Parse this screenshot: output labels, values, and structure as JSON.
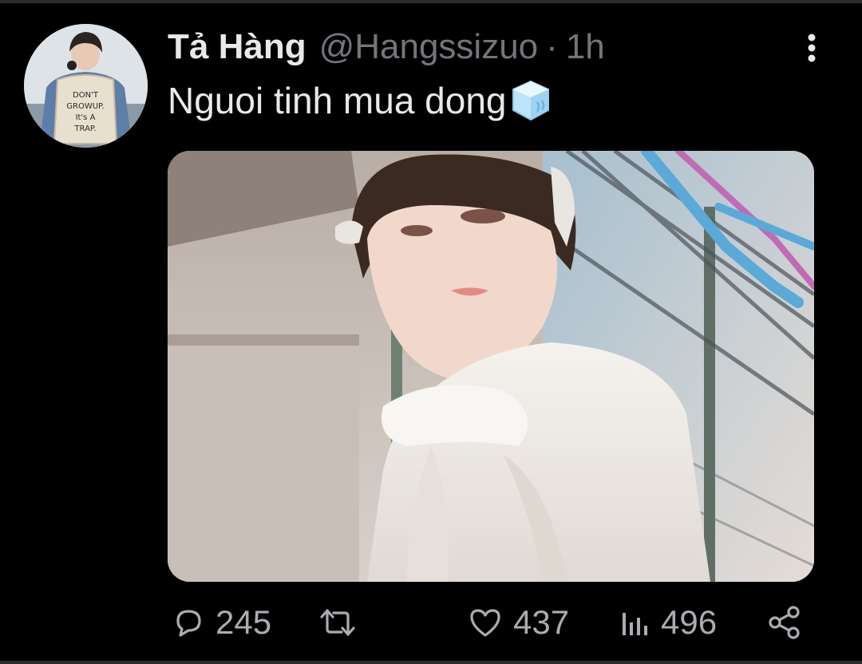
{
  "tweet": {
    "author_name": "Tả Hàng",
    "handle": "@Hangssizuo",
    "separator": "·",
    "time": "1h",
    "text": "Nguoi tinh mua dong",
    "emoji": "ice-cube-emoji",
    "avatar_shirt_text": [
      "DON'T",
      "GROWUP.",
      "It's A",
      "TRAP."
    ]
  },
  "actions": {
    "reply_count": "245",
    "retweet_count": "",
    "like_count": "437",
    "view_count": "496"
  },
  "icons": [
    "more-vertical-icon",
    "reply-icon",
    "retweet-icon",
    "like-icon",
    "views-icon",
    "share-icon"
  ],
  "colors": {
    "background": "#000000",
    "primary_text": "#e7e9ea",
    "secondary_text": "#71767b",
    "action_icon": "#a9adb1"
  }
}
